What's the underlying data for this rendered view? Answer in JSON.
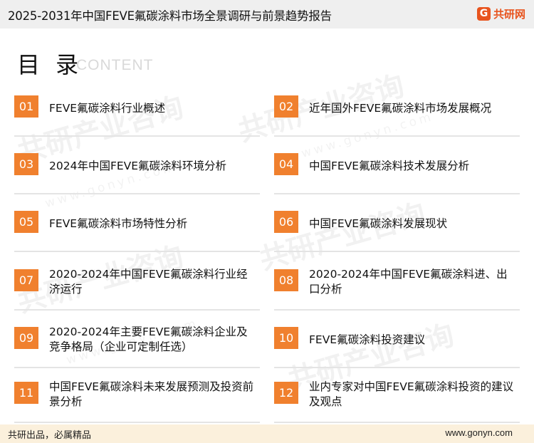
{
  "header": {
    "title": "2025-2031年中国FEVE氟碳涂料市场全景调研与前景趋势报告",
    "brand": "共研网",
    "brand_mark": "G"
  },
  "heading": {
    "title": "目 录",
    "subtitle": "CONTENT"
  },
  "toc": [
    {
      "num": "01",
      "label": "FEVE氟碳涂料行业概述"
    },
    {
      "num": "02",
      "label": "近年国外FEVE氟碳涂料市场发展概况"
    },
    {
      "num": "03",
      "label": "2024年中国FEVE氟碳涂料环境分析"
    },
    {
      "num": "04",
      "label": "中国FEVE氟碳涂料技术发展分析"
    },
    {
      "num": "05",
      "label": "FEVE氟碳涂料市场特性分析"
    },
    {
      "num": "06",
      "label": "中国FEVE氟碳涂料发展现状"
    },
    {
      "num": "07",
      "label": "2020-2024年中国FEVE氟碳涂料行业经济运行"
    },
    {
      "num": "08",
      "label": "2020-2024年中国FEVE氟碳涂料进、出口分析"
    },
    {
      "num": "09",
      "label": "2020-2024年主要FEVE氟碳涂料企业及竞争格局（企业可定制任选）"
    },
    {
      "num": "10",
      "label": "FEVE氟碳涂料投资建议"
    },
    {
      "num": "11",
      "label": "中国FEVE氟碳涂料未来发展预测及投资前景分析"
    },
    {
      "num": "12",
      "label": "业内专家对中国FEVE氟碳涂料投资的建议及观点"
    }
  ],
  "watermark": {
    "text": "共研产业咨询",
    "url": "www.gonyn.com"
  },
  "footer": {
    "slogan": "共研出品，必属精品",
    "website": "www.gonyn.com"
  },
  "colors": {
    "accent": "#f0802e",
    "brand": "#e8541e",
    "footer_bg": "#fbf0dc",
    "header_bg": "#efefef"
  }
}
